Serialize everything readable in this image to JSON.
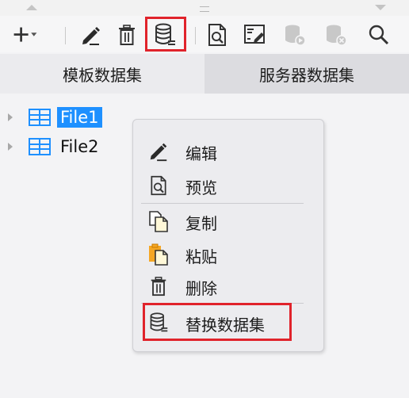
{
  "toolbar": {
    "add_icon": "plus-dropdown-icon",
    "edit_icon": "pencil-icon",
    "delete_icon": "trash-icon",
    "replace_dataset_icon": "database-replace-icon",
    "preview_icon": "preview-icon",
    "sql_dataset_icon": "database-edit-icon",
    "play_dataset_icon": "database-play-icon",
    "remove_dataset_icon": "database-remove-icon",
    "search_icon": "search-icon"
  },
  "tabs": [
    {
      "label": "模板数据集",
      "active": true
    },
    {
      "label": "服务器数据集",
      "active": false
    }
  ],
  "tree": {
    "items": [
      {
        "label": "File1",
        "selected": true
      },
      {
        "label": "File2",
        "selected": false
      }
    ]
  },
  "context_menu": {
    "items": [
      {
        "label": "编辑",
        "icon": "pencil-icon"
      },
      {
        "label": "预览",
        "icon": "preview-icon"
      },
      {
        "label": "复制",
        "icon": "copy-icon"
      },
      {
        "label": "粘贴",
        "icon": "paste-icon"
      },
      {
        "label": "删除",
        "icon": "trash-icon"
      },
      {
        "label": "替换数据集",
        "icon": "database-replace-icon"
      }
    ]
  },
  "colors": {
    "highlight_red": "#e0232b",
    "selection_blue": "#1e90ff",
    "dataset_icon_blue": "#1e90ff"
  }
}
